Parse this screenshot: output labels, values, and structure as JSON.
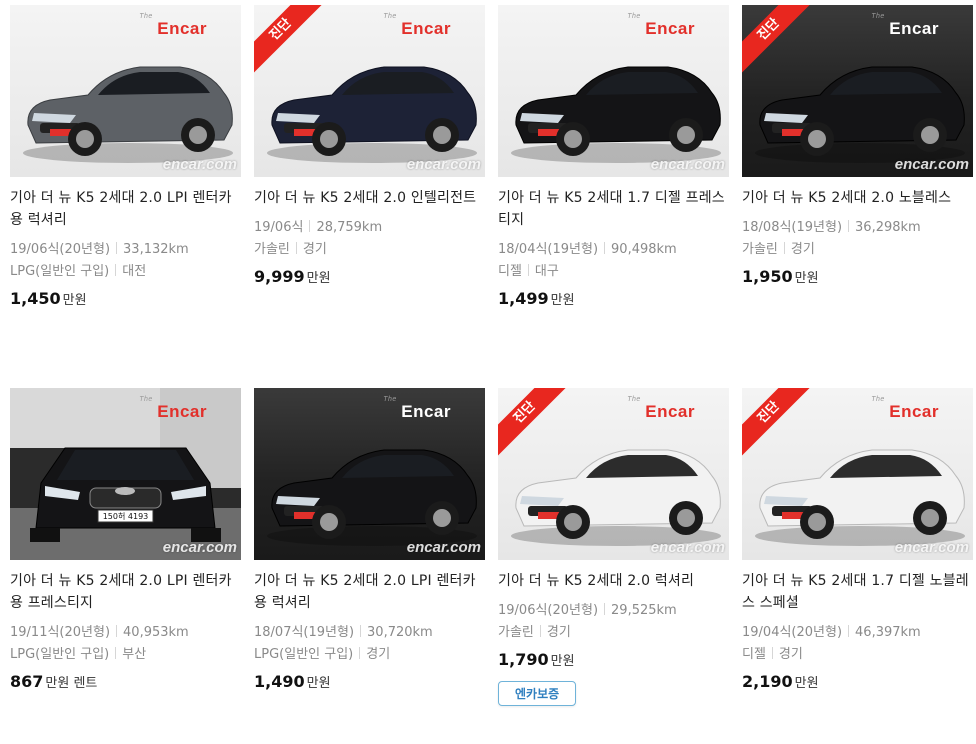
{
  "brand_logo": "Encar",
  "brand_logo_prefix": "The",
  "watermark": "encar.com",
  "price_unit": "만원",
  "plate_text": "150허 4193",
  "colors": {
    "ribbon": "#e8271f",
    "brand": "#e2302b",
    "badge_border": "#6fb3d9",
    "badge_text": "#2f7fbf"
  },
  "cards": [
    {
      "title": "기아 더 뉴 K5 2세대 2.0 LPI 렌터카용 럭셔리",
      "year": "19/06식(20년형)",
      "mileage": "33,132km",
      "fuel": "LPG(일반인 구입)",
      "region": "대전",
      "price": "1,450",
      "price_suffix": "",
      "ribbon": "",
      "car_color": "gray",
      "bg": "light",
      "badge": ""
    },
    {
      "title": "기아 더 뉴 K5 2세대 2.0 인텔리전트",
      "year": "19/06식",
      "mileage": "28,759km",
      "fuel": "가솔린",
      "region": "경기",
      "price": "9,999",
      "price_suffix": "",
      "ribbon": "진단",
      "car_color": "navy",
      "bg": "light",
      "badge": ""
    },
    {
      "title": "기아 더 뉴 K5 2세대 1.7 디젤 프레스티지",
      "year": "18/04식(19년형)",
      "mileage": "90,498km",
      "fuel": "디젤",
      "region": "대구",
      "price": "1,499",
      "price_suffix": "",
      "ribbon": "",
      "car_color": "black",
      "bg": "light",
      "badge": ""
    },
    {
      "title": "기아 더 뉴 K5 2세대 2.0 노블레스",
      "year": "18/08식(19년형)",
      "mileage": "36,298km",
      "fuel": "가솔린",
      "region": "경기",
      "price": "1,950",
      "price_suffix": "",
      "ribbon": "진단",
      "car_color": "black",
      "bg": "dark",
      "badge": ""
    },
    {
      "title": "기아 더 뉴 K5 2세대 2.0 LPI 렌터카용 프레스티지",
      "year": "19/11식(20년형)",
      "mileage": "40,953km",
      "fuel": "LPG(일반인 구입)",
      "region": "부산",
      "price": "867",
      "price_suffix": "렌트",
      "ribbon": "",
      "car_color": "black",
      "bg": "light",
      "badge": ""
    },
    {
      "title": "기아 더 뉴 K5 2세대 2.0 LPI 렌터카용 럭셔리",
      "year": "18/07식(19년형)",
      "mileage": "30,720km",
      "fuel": "LPG(일반인 구입)",
      "region": "경기",
      "price": "1,490",
      "price_suffix": "",
      "ribbon": "",
      "car_color": "black",
      "bg": "dark",
      "badge": ""
    },
    {
      "title": "기아 더 뉴 K5 2세대 2.0 럭셔리",
      "year": "19/06식(20년형)",
      "mileage": "29,525km",
      "fuel": "가솔린",
      "region": "경기",
      "price": "1,790",
      "price_suffix": "",
      "ribbon": "진단",
      "car_color": "white",
      "bg": "light",
      "badge": "엔카보증"
    },
    {
      "title": "기아 더 뉴 K5 2세대 1.7 디젤 노블레스 스페셜",
      "year": "19/04식(20년형)",
      "mileage": "46,397km",
      "fuel": "디젤",
      "region": "경기",
      "price": "2,190",
      "price_suffix": "",
      "ribbon": "진단",
      "car_color": "white",
      "bg": "light",
      "badge": ""
    }
  ]
}
